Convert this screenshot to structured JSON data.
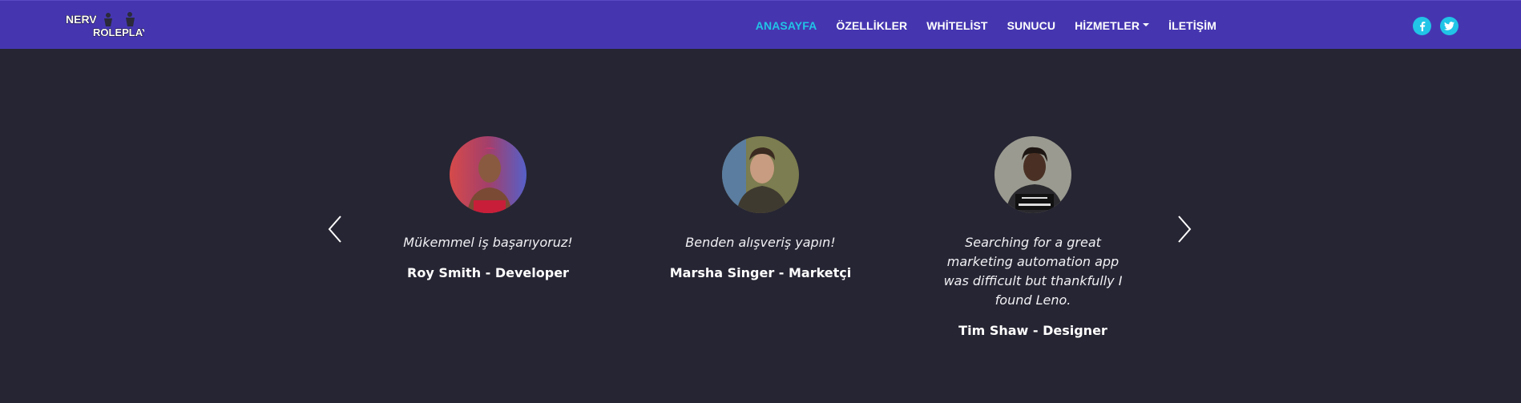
{
  "brand": {
    "logo_text_line1": "NERV",
    "logo_text_line2": "ROLEPLAY"
  },
  "nav": {
    "items": [
      {
        "label": "ANASAYFA",
        "active": true
      },
      {
        "label": "ÖZELLİKLER",
        "active": false
      },
      {
        "label": "WHİTELİST",
        "active": false
      },
      {
        "label": "SUNUCU",
        "active": false
      },
      {
        "label": "HİZMETLER",
        "active": false,
        "dropdown": true
      },
      {
        "label": "İLETİŞİM",
        "active": false
      }
    ],
    "social": [
      {
        "icon": "facebook-icon"
      },
      {
        "icon": "twitter-icon"
      }
    ]
  },
  "colors": {
    "navbar_bg": "#4536b0",
    "page_bg": "#262533",
    "accent": "#21c4e6"
  },
  "testimonials": [
    {
      "quote": "Mükemmel iş başarıyoruz!",
      "author": "Roy Smith - Developer"
    },
    {
      "quote": "Benden alışveriş yapın!",
      "author": "Marsha Singer - Marketçi"
    },
    {
      "quote": "Searching for a great marketing automation app was difficult but thankfully I found Leno.",
      "author": "Tim Shaw - Designer"
    }
  ],
  "carousel": {
    "prev_icon": "chevron-left-icon",
    "next_icon": "chevron-right-icon"
  }
}
